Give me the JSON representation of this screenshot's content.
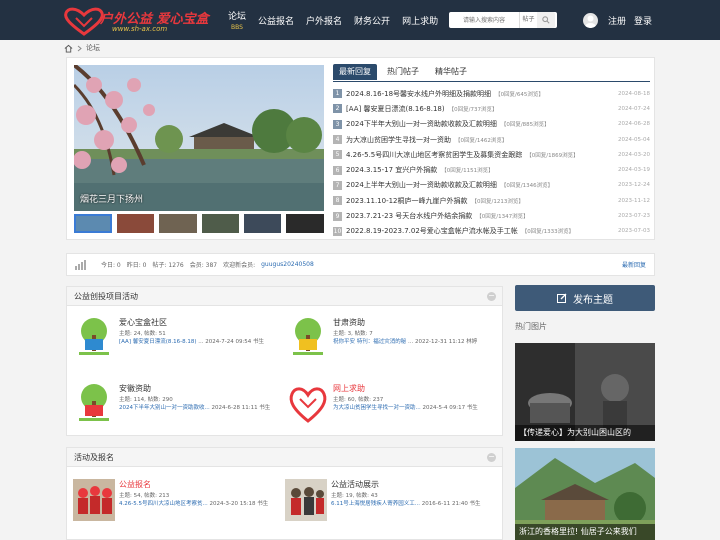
{
  "header": {
    "logo_text": "户外公益 爱心宝盒",
    "logo_url": "www.sh-ax.com",
    "nav": [
      {
        "label": "论坛",
        "sub": "BBS"
      },
      {
        "label": "公益报名",
        "sub": ""
      },
      {
        "label": "户外报名",
        "sub": ""
      },
      {
        "label": "财务公开",
        "sub": ""
      },
      {
        "label": "网上求助",
        "sub": ""
      }
    ],
    "search_placeholder": "请输入搜索内容",
    "search_type": "帖子",
    "register": "注册",
    "login": "登录"
  },
  "breadcrumb": {
    "current": "论坛"
  },
  "slideshow": {
    "caption": "烟花三月下扬州"
  },
  "tabs": [
    "最新回复",
    "热门帖子",
    "精华帖子"
  ],
  "posts": [
    {
      "num": "1",
      "title": "2024.8.16-18号馨安水线户外明细及捐款明细",
      "meta": "【0回复/645浏览】",
      "date": "2024-08-18"
    },
    {
      "num": "2",
      "title": "[AA] 馨安夏日漂流(8.16-8.18)",
      "meta": "【0回复/737浏览】",
      "date": "2024-07-24"
    },
    {
      "num": "3",
      "title": "2024下半年大别山一对一资助款收款及汇款明细",
      "meta": "【0回复/885浏览】",
      "date": "2024-06-28"
    },
    {
      "num": "4",
      "title": "为大凉山贫困学生寻找一对一资助",
      "meta": "【0回复/1462浏览】",
      "date": "2024-05-04"
    },
    {
      "num": "5",
      "title": "4.26-5.5号四川大凉山地区考察贫困学生及募集资金跟踪",
      "meta": "【0回复/1869浏览】",
      "date": "2024-03-20"
    },
    {
      "num": "6",
      "title": "2024.3.15-17 宜兴户外捐款",
      "meta": "【0回复/1151浏览】",
      "date": "2024-03-19"
    },
    {
      "num": "7",
      "title": "2024上半年大别山一对一资助款收款及汇款明细",
      "meta": "【0回复/1346浏览】",
      "date": "2023-12-24"
    },
    {
      "num": "8",
      "title": "2023.11.10-12桐庐一峰九崖户外捐款",
      "meta": "【0回复/1213浏览】",
      "date": "2023-11-12"
    },
    {
      "num": "9",
      "title": "2023.7.21-23 号天台水线户外结余捐款",
      "meta": "【0回复/1347浏览】",
      "date": "2023-07-23"
    },
    {
      "num": "10",
      "title": "2022.8.19-2023.7.02号爱心宝盒帐户流水帐及手工帐",
      "meta": "【0回复/1333浏览】",
      "date": "2023-07-03"
    }
  ],
  "stats": {
    "today": "今日: 0",
    "yesterday": "昨日: 0",
    "posts": "帖子: 1276",
    "members": "会员: 387",
    "welcome": "欢迎新会员:",
    "new_member": "guugus20240508",
    "latest": "最新回复"
  },
  "section1": {
    "title": "公益创投项目活动",
    "forums": [
      {
        "name": "爱心宝盒社区",
        "stat": "主题: 24, 帖数: 51",
        "last_link": "[AA] 馨安夏日漂流(8.16-8.18)",
        "last_time": "... 2024-7-24 09:54 书生"
      },
      {
        "name": "甘肃资助",
        "stat": "主题: 3, 帖数: 7",
        "last_link": "祝你平安 特刊：福过灾消的秘",
        "last_time": "... 2022-12-31 11:12 林婷"
      },
      {
        "name": "安徽资助",
        "stat": "主题: 114, 帖数: 290",
        "last_link": "2024下半年大别山一对一资助款收...",
        "last_time": "2024-6-28 11:11 书生"
      },
      {
        "name": "网上求助",
        "stat": "主题: 60, 帖数: 237",
        "last_link": "为大凉山贫困学生寻找一对一资助...",
        "last_time": "2024-5-4 09:17 书生"
      }
    ]
  },
  "section2": {
    "title": "活动及报名",
    "forums": [
      {
        "name": "公益报名",
        "stat": "主题: 54, 帖数: 213",
        "last_link": "4.26-5.5号四川大凉山地区考察贫...",
        "last_time": "2024-3-20 15:18 书生"
      },
      {
        "name": "公益活动展示",
        "stat": "主题: 19, 帖数: 43",
        "last_link": "6.11号上海悦居残疾人寄养园义工...",
        "last_time": "2016-6-11 21:40 书生"
      }
    ]
  },
  "sidebar": {
    "publish": "发布主题",
    "hot_pics": "热门图片",
    "pics": [
      {
        "caption": "【传递爱心】为大别山困山区的"
      },
      {
        "caption": "浙江的香格里拉! 仙居子公来我们"
      }
    ]
  }
}
